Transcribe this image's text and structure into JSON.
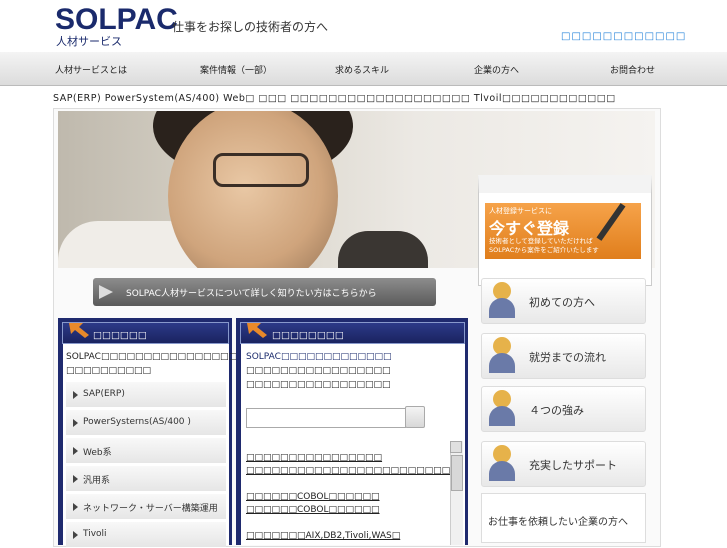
{
  "header": {
    "logo": "SOLPAC",
    "logo_sub": "人材サービス",
    "tagline": "仕事をお探しの技術者の方へ",
    "top_right": "□□□□□□□□□□□□"
  },
  "nav": {
    "items": [
      "人材サービスとは",
      "案件情報（一部）",
      "求めるスキル",
      "企業の方へ",
      "お問合わせ"
    ]
  },
  "subtitle": "SAP(ERP) PowerSystem(AS/400) Web□ □□□ □□□□□□□□□□□□□□□□□□□ Tlvoil□□□□□□□□□□□□",
  "hero": {
    "register_small": "人材登録サービスに",
    "register_big": "今すぐ登録",
    "register_note_1": "技術者として登録していただければ",
    "register_note_2": "SOLPACから案件をご紹介いたします"
  },
  "more_link": "SOLPAC人材サービスについて詳しく知りたい方はこちらから",
  "left_panel": {
    "title": "□□□□□□",
    "intro_1": "SOLPAC□□□□□□□□□□□□□□□□□",
    "intro_2": "□□□□□□□□□□",
    "categories": [
      "SAP(ERP)",
      "PowerSysterns(AS/400 )",
      "Web系",
      "汎用系",
      "ネットワーク・サーバー構築運用",
      "Tivoli"
    ]
  },
  "mid_panel": {
    "title": "□□□□□□□□",
    "intro_1": "SOLPAC□□□□□□□□□□□□□",
    "intro_2": "□□□□□□□□□□□□□□□□□",
    "intro_3": "□□□□□□□□□□□□□□□□□",
    "search_value": "",
    "jobs": [
      {
        "line1": "□□□□□□□□□□□□□□□□",
        "line2": "□□□□□□□□□□□□□□□□□□□□□□□□"
      },
      {
        "line1": "□□□□□□COBOL□□□□□□",
        "line2": "□□□□□□COBOL□□□□□□"
      },
      {
        "line1": "□□□□□□□AIX,DB2,Tivoli,WAS□",
        "line2": ""
      }
    ]
  },
  "side": {
    "buttons": [
      "初めての方へ",
      "就労までの流れ",
      "４つの強み",
      "充実したサポート"
    ],
    "company_link": "お仕事を依頼したい企業の方へ"
  },
  "colors": {
    "navy": "#1f2a6e",
    "orange": "#e8892a",
    "link_blue": "#1e7fd8"
  }
}
